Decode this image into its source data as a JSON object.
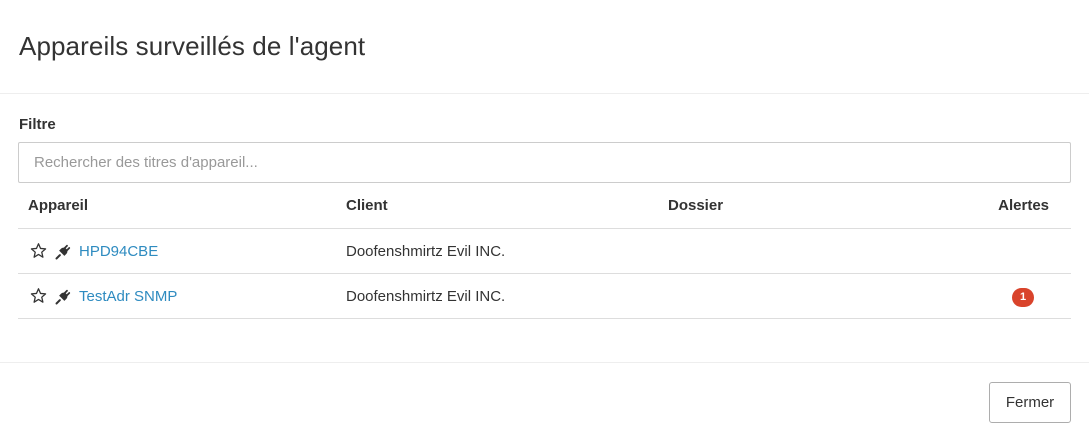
{
  "dialog": {
    "title": "Appareils surveillés de l'agent"
  },
  "filter": {
    "label": "Filtre",
    "placeholder": "Rechercher des titres d'appareil...",
    "value": ""
  },
  "table": {
    "headers": {
      "device": "Appareil",
      "client": "Client",
      "folder": "Dossier",
      "alerts": "Alertes"
    },
    "rows": [
      {
        "device": "HPD94CBE",
        "client": "Doofenshmirtz Evil INC.",
        "folder": "",
        "alerts": ""
      },
      {
        "device": "TestAdr SNMP",
        "client": "Doofenshmirtz Evil INC.",
        "folder": "",
        "alerts": "1"
      }
    ]
  },
  "icons": {
    "favorite": "star-outline-icon",
    "device_type": "plug-icon"
  },
  "colors": {
    "link": "#2e8bc0",
    "alert_badge": "#d9432b"
  },
  "footer": {
    "close_label": "Fermer"
  }
}
